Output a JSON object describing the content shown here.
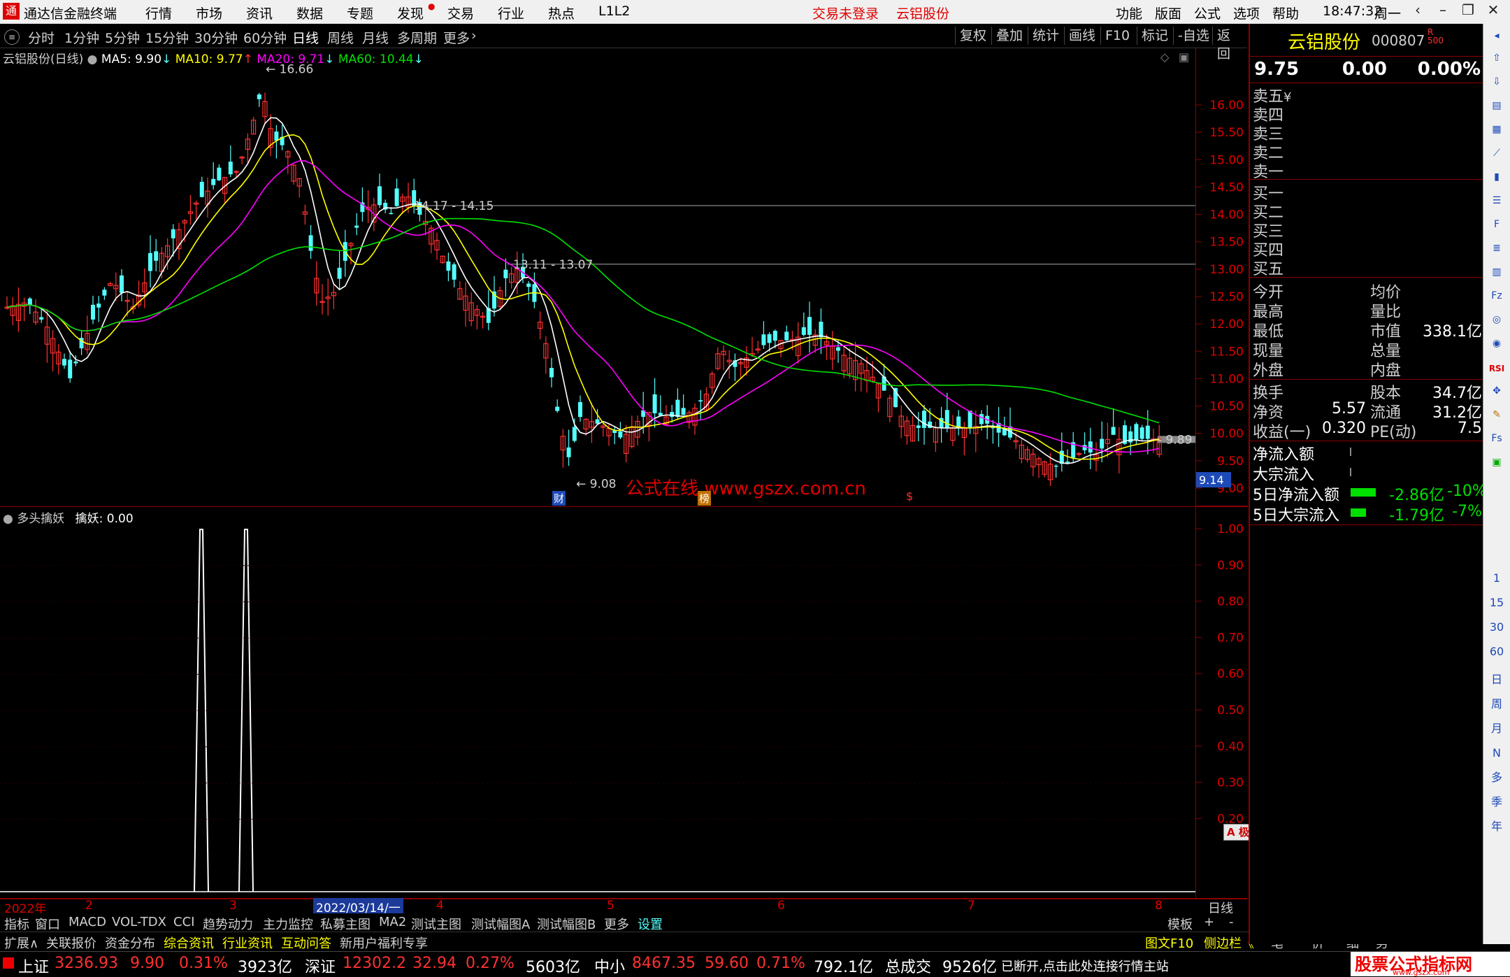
{
  "menubar": {
    "app_title": "通达信金融终端",
    "menus": [
      "行情",
      "市场",
      "资讯",
      "数据",
      "专题",
      "发现",
      "交易",
      "行业",
      "热点",
      "L1L2"
    ],
    "login_status": "交易未登录",
    "stock_title": "云铝股份",
    "right_menus": [
      "功能",
      "版面",
      "公式",
      "选项",
      "帮助"
    ],
    "time": "18:47:32",
    "weekday": "周一"
  },
  "period_tabs": [
    "分时",
    "1分钟",
    "5分钟",
    "15分钟",
    "30分钟",
    "60分钟",
    "日线",
    "周线",
    "月线",
    "多周期",
    "更多"
  ],
  "active_period": "日线",
  "toolbar_buttons": [
    "复权",
    "叠加",
    "统计",
    "画线",
    "F10",
    "标记",
    "-自选",
    "返回"
  ],
  "chart_header": {
    "name": "云铝股份(日线)",
    "ma5": "MA5: 9.90",
    "ma10": "MA10: 9.77",
    "ma20": "MA20: 9.71",
    "ma60": "MA60: 10.44"
  },
  "chart_annotations": {
    "high": "16.66",
    "low": "9.08",
    "line1": "14.17 - 14.15",
    "line2": "13.11 - 13.07",
    "last": "9.89",
    "cursor": "9.14",
    "watermark": "公式在线  www.gszx.com.cn",
    "badge_cai": "财",
    "badge_bang": "榜",
    "badge_s": "$"
  },
  "colors": {
    "up": "#ff3030",
    "down": "#54ffff",
    "ma5": "#ffffff",
    "ma10": "#ffff00",
    "ma20": "#ff00ff",
    "ma60": "#00e000",
    "axis_border": "#8b0000"
  },
  "price_axis": [
    "16.00",
    "15.50",
    "15.00",
    "14.50",
    "14.00",
    "13.50",
    "13.00",
    "12.50",
    "12.00",
    "11.50",
    "11.00",
    "10.50",
    "10.00",
    "9.50",
    "9.00"
  ],
  "sub_header": {
    "name": "多头擒妖",
    "value": "擒妖: 0.00"
  },
  "sub_axis": [
    "1.00",
    "0.90",
    "0.80",
    "0.70",
    "0.60",
    "0.50",
    "0.40",
    "0.30",
    "0.20"
  ],
  "date_axis": {
    "labels": [
      "2022年",
      "2",
      "3",
      "2022/03/14/一",
      "4",
      "5",
      "6",
      "7",
      "8"
    ],
    "period": "日线"
  },
  "bottom_tabs": [
    "指标",
    "窗口",
    "MACD",
    "VOL-TDX",
    "CCI",
    "趋势动力",
    "主力监控",
    "私募主图",
    "MA2",
    "测试主图",
    "测试幅图A",
    "测试幅图B",
    "更多",
    "设置"
  ],
  "bottom_right": [
    "模板",
    "+",
    "-"
  ],
  "bottom_tabs2": [
    "扩展∧",
    "关联报价",
    "资金分布",
    "综合资讯",
    "行业资讯",
    "互动问答",
    "新用户福利专享"
  ],
  "bottom_tabs2_right": [
    "图文F10",
    "侧边栏《",
    "笔",
    "价",
    "细",
    "势"
  ],
  "ime_bar": "A 极品五笔",
  "quote_panel": {
    "name": "云铝股份",
    "code": "000807",
    "code_flags": "R 500",
    "price": "9.75",
    "change": "0.00",
    "pct": "0.00%",
    "sell": [
      "卖五",
      "卖四",
      "卖三",
      "卖二",
      "卖一"
    ],
    "sell5_suffix": "¥",
    "buy": [
      "买一",
      "买二",
      "买三",
      "买四",
      "买五"
    ],
    "stats": [
      {
        "l": "今开",
        "lv": "",
        "r": "均价",
        "rv": ""
      },
      {
        "l": "最高",
        "lv": "",
        "r": "量比",
        "rv": ""
      },
      {
        "l": "最低",
        "lv": "",
        "r": "市值",
        "rv": "338.1亿"
      },
      {
        "l": "现量",
        "lv": "",
        "r": "总量",
        "rv": ""
      },
      {
        "l": "外盘",
        "lv": "",
        "r": "内盘",
        "rv": ""
      }
    ],
    "fund": [
      {
        "l": "换手",
        "lv": "",
        "r": "股本",
        "rv": "34.7亿"
      },
      {
        "l": "净资",
        "lv": "5.57",
        "r": "流通",
        "rv": "31.2亿"
      },
      {
        "l": "收益(一)",
        "lv": "0.320",
        "r": "PE(动)",
        "rv": "7.5"
      }
    ],
    "flows": [
      {
        "l": "净流入额",
        "v": "",
        "p": ""
      },
      {
        "l": "大宗流入",
        "v": "",
        "p": ""
      },
      {
        "l": "5日净流入额",
        "v": "-2.86亿",
        "p": "-10%"
      },
      {
        "l": "5日大宗流入",
        "v": "-1.79亿",
        "p": "-7%"
      }
    ]
  },
  "right_toolbar": [
    "1",
    "15",
    "30",
    "60",
    "日",
    "周",
    "月",
    "N",
    "多",
    "季",
    "年"
  ],
  "status_bar": {
    "sh": {
      "name": "上证",
      "val": "3236.93",
      "chg": "9.90",
      "pct": "0.31%",
      "amt": "3923亿"
    },
    "sz": {
      "name": "深证",
      "val": "12302.2",
      "chg": "32.94",
      "pct": "0.27%",
      "amt": "5603亿"
    },
    "zx": {
      "name": "中小",
      "val": "8467.35",
      "chg": "59.60",
      "pct": "0.71%",
      "amt": "792.1亿"
    },
    "total_label": "总成交",
    "total": "9526亿",
    "msg": "已断开,点击此处连接行情主站",
    "brand": "股票公式指标网",
    "brand_url": "www.gszx.com"
  }
}
